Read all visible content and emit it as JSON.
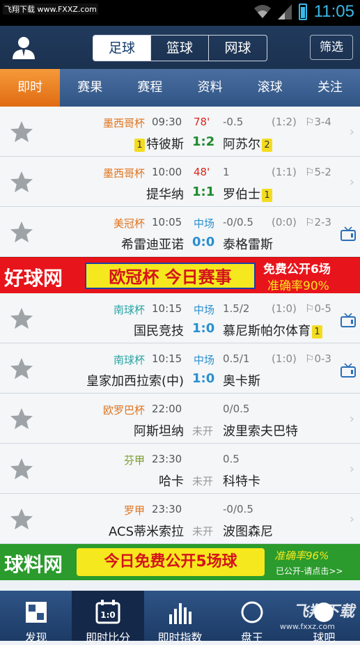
{
  "status": {
    "watermark": "飞翔下载 www.FXXZ.com",
    "time": "11:05"
  },
  "header": {
    "sport_tabs": [
      {
        "label": "足球",
        "active": true
      },
      {
        "label": "篮球",
        "active": false
      },
      {
        "label": "网球",
        "active": false
      }
    ],
    "filter_label": "筛选"
  },
  "subnav": [
    {
      "label": "即时",
      "active": true
    },
    {
      "label": "赛果"
    },
    {
      "label": "赛程"
    },
    {
      "label": "资料"
    },
    {
      "label": "滚球"
    },
    {
      "label": "关注"
    }
  ],
  "matches": [
    {
      "league": "墨西哥杯",
      "league_color": "#e0731c",
      "time": "09:30",
      "state": "78'",
      "state_color": "#d9261c",
      "handicap": "-0.5",
      "half": "(1:2)",
      "corner": "⚐3-4",
      "home": "特彼斯",
      "home_card": "1",
      "score": "1:2",
      "score_color": "#1f8a2c",
      "away": "阿苏尔",
      "away_card": "2",
      "tv": false
    },
    {
      "league": "墨西哥杯",
      "league_color": "#e0731c",
      "time": "10:00",
      "state": "48'",
      "state_color": "#d9261c",
      "handicap": "1",
      "half": "(1:1)",
      "corner": "⚐5-2",
      "home": "提华纳",
      "home_card": "",
      "score": "1:1",
      "score_color": "#1f8a2c",
      "away": "罗伯士",
      "away_card": "1",
      "tv": false
    },
    {
      "league": "美冠杯",
      "league_color": "#e0731c",
      "time": "10:05",
      "state": "中场",
      "state_color": "#2a8fd0",
      "handicap": "-0/0.5",
      "half": "(0:0)",
      "corner": "⚐2-3",
      "home": "希雷迪亚诺",
      "home_card": "",
      "score": "0:0",
      "score_color": "#2a8fd0",
      "away": "泰格雷斯",
      "away_card": "",
      "tv": true
    }
  ],
  "ad1": {
    "site": "好球网",
    "headline": "欧冠杯 今日赛事",
    "line1": "免费公开6场",
    "line2": "准确率90%"
  },
  "matches2": [
    {
      "league": "南球杯",
      "league_color": "#2aa3a3",
      "time": "10:15",
      "state": "中场",
      "state_color": "#2a8fd0",
      "handicap": "1.5/2",
      "half": "(1:0)",
      "corner": "⚐0-5",
      "home": "国民竞技",
      "home_card": "",
      "score": "1:0",
      "score_color": "#2a8fd0",
      "away": "慕尼斯帕尔体育",
      "away_card": "1",
      "tv": true
    },
    {
      "league": "南球杯",
      "league_color": "#2aa3a3",
      "time": "10:15",
      "state": "中场",
      "state_color": "#2a8fd0",
      "handicap": "0.5/1",
      "half": "(1:0)",
      "corner": "⚐0-3",
      "home": "皇家加西拉索(中)",
      "home_card": "",
      "score": "1:0",
      "score_color": "#2a8fd0",
      "away": "奥卡斯",
      "away_card": "",
      "tv": true
    },
    {
      "league": "欧罗巴杯",
      "league_color": "#e0731c",
      "time": "22:00",
      "state": "",
      "state_color": "#999",
      "handicap": "0/0.5",
      "half": "",
      "corner": "",
      "home": "阿斯坦纳",
      "home_card": "",
      "score": "未开",
      "score_color": "#999",
      "away": "波里索夫巴特",
      "away_card": "",
      "tv": false
    },
    {
      "league": "芬甲",
      "league_color": "#7a9a2a",
      "time": "23:30",
      "state": "",
      "state_color": "#999",
      "handicap": "0.5",
      "half": "",
      "corner": "",
      "home": "哈卡",
      "home_card": "",
      "score": "未开",
      "score_color": "#999",
      "away": "科特卡",
      "away_card": "",
      "tv": false
    },
    {
      "league": "罗甲",
      "league_color": "#e0731c",
      "time": "23:30",
      "state": "",
      "state_color": "#999",
      "handicap": "-0/0.5",
      "half": "",
      "corner": "",
      "home": "ACS蒂米索拉",
      "home_card": "",
      "score": "未开",
      "score_color": "#999",
      "away": "波图森尼",
      "away_card": "",
      "tv": false
    }
  ],
  "ad2": {
    "site": "球料网",
    "headline": "今日免费公开5场球",
    "line1": "准确率96%",
    "line2": "已公开-请点击>>"
  },
  "bottom_tabs": [
    {
      "label": "发现",
      "icon": "discover-icon"
    },
    {
      "label": "即时比分",
      "icon": "scoreboard-icon",
      "active": true
    },
    {
      "label": "即时指数",
      "icon": "bar-chart-icon"
    },
    {
      "label": "盘王",
      "icon": "king-icon"
    },
    {
      "label": "球吧",
      "icon": "ball-icon"
    }
  ],
  "watermark_bottom": {
    "brand": "飞翔下载",
    "url": "www.fxxz.com"
  }
}
